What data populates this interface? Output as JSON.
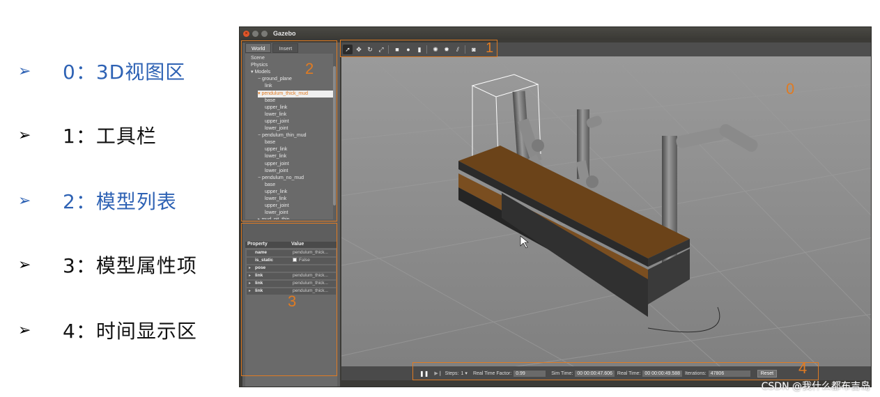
{
  "slide": {
    "items": [
      {
        "arrow": "➢",
        "text": "0：3D视图区"
      },
      {
        "arrow": "➢",
        "text": "1：工具栏"
      },
      {
        "arrow": "➢",
        "text": "2：模型列表"
      },
      {
        "arrow": "➢",
        "text": "3：模型属性项"
      },
      {
        "arrow": "➢",
        "text": "4：时间显示区"
      }
    ],
    "highlight_color": "#2e62b4"
  },
  "window": {
    "title": "Gazebo",
    "close_glyph": "×"
  },
  "left_panel": {
    "tabs": [
      "World",
      "Insert"
    ],
    "tree": [
      "Scene",
      "Physics",
      "Models",
      "ground_plane",
      "link",
      "pendulum_thick_mud",
      "base",
      "upper_link",
      "lower_link",
      "upper_joint",
      "lower_joint",
      "pendulum_thin_mud",
      "base",
      "upper_link",
      "lower_link",
      "upper_joint",
      "lower_joint",
      "pendulum_no_mud",
      "base",
      "upper_link",
      "lower_link",
      "upper_joint",
      "lower_joint",
      "mud_pit_thin"
    ],
    "selected": "pendulum_thick_mud"
  },
  "properties": {
    "header": {
      "property": "Property",
      "value": "Value"
    },
    "rows": [
      {
        "name": "name",
        "value": "pendulum_thick...",
        "expander": ""
      },
      {
        "name": "is_static",
        "value": "False",
        "expander": "",
        "checkbox": true
      },
      {
        "name": "pose",
        "value": "",
        "expander": "▸"
      },
      {
        "name": "link",
        "value": "pendulum_thick...",
        "expander": "▸"
      },
      {
        "name": "link",
        "value": "pendulum_thick...",
        "expander": "▸"
      },
      {
        "name": "link",
        "value": "pendulum_thick...",
        "expander": "▸"
      }
    ]
  },
  "toolbar": {
    "tools": [
      {
        "icon": "select-arrow-icon",
        "glyph": "➚",
        "active": true
      },
      {
        "icon": "translate-icon",
        "glyph": "✥",
        "active": false
      },
      {
        "icon": "rotate-icon",
        "glyph": "↻",
        "active": false
      },
      {
        "icon": "scale-icon",
        "glyph": "⤢",
        "active": false
      },
      {
        "sep": true
      },
      {
        "icon": "box-shape-icon",
        "glyph": "■",
        "active": false
      },
      {
        "icon": "sphere-shape-icon",
        "glyph": "●",
        "active": false
      },
      {
        "icon": "cylinder-shape-icon",
        "glyph": "▮",
        "active": false
      },
      {
        "sep": true
      },
      {
        "icon": "point-light-icon",
        "glyph": "✺",
        "active": false
      },
      {
        "icon": "spot-light-icon",
        "glyph": "✹",
        "active": false
      },
      {
        "icon": "directional-light-icon",
        "glyph": "⫽",
        "active": false
      },
      {
        "sep": true
      },
      {
        "icon": "screenshot-icon",
        "glyph": "◙",
        "active": false
      }
    ]
  },
  "statusbar": {
    "pause_glyph": "❚❚",
    "step_glyph": "▶❙",
    "steps_label": "Steps:",
    "steps_value": "1",
    "rtf_label": "Real Time Factor:",
    "rtf_value": "0.99",
    "sim_label": "Sim Time:",
    "sim_value": "00 00:00:47.606",
    "real_label": "Real Time:",
    "real_value": "00 00:00:49.588",
    "iter_label": "Iterations:",
    "iter_value": "47806",
    "reset_label": "Reset"
  },
  "annotations": {
    "n0": "0",
    "n1": "1",
    "n2": "2",
    "n3": "3",
    "n4": "4",
    "color": "#e07b22"
  },
  "watermark": "CSDN @我什么都布吉岛"
}
